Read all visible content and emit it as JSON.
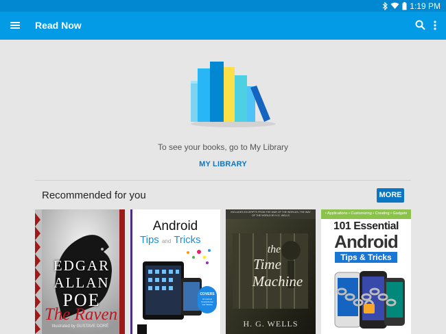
{
  "status_bar": {
    "time": "1:19 PM"
  },
  "app_bar": {
    "title": "Read Now"
  },
  "empty_state": {
    "message": "To see your books, go to My Library",
    "link": "MY LIBRARY"
  },
  "recommended": {
    "title": "Recommended for you",
    "more_label": "MORE",
    "books": [
      {
        "line1": "EDGAR",
        "line2": "ALLAN",
        "line3": "POE",
        "subtitle": "The Raven",
        "credit": "Illustrated by GUSTAVE DORÉ"
      },
      {
        "line1": "Android",
        "line2": "Tips",
        "line2b": "and",
        "line3": "Tricks",
        "badge1": "COVERS",
        "badge2": "All Android Smartphones and Tablets"
      },
      {
        "top_text": "INCLUDES EXCERPTS FROM THE WAR OF THE WORLDS, THE WAY OF THE WORLD BY H.G. WELLS",
        "line1": "the",
        "line2": "Time",
        "line3": "Machine",
        "author": "H. G. WELLS"
      },
      {
        "top_bar": "• Applications • Customizing • Creating • Gadgets",
        "line1": "101 Essential",
        "line2": "Android",
        "line3": "Tips & Tricks"
      }
    ]
  }
}
